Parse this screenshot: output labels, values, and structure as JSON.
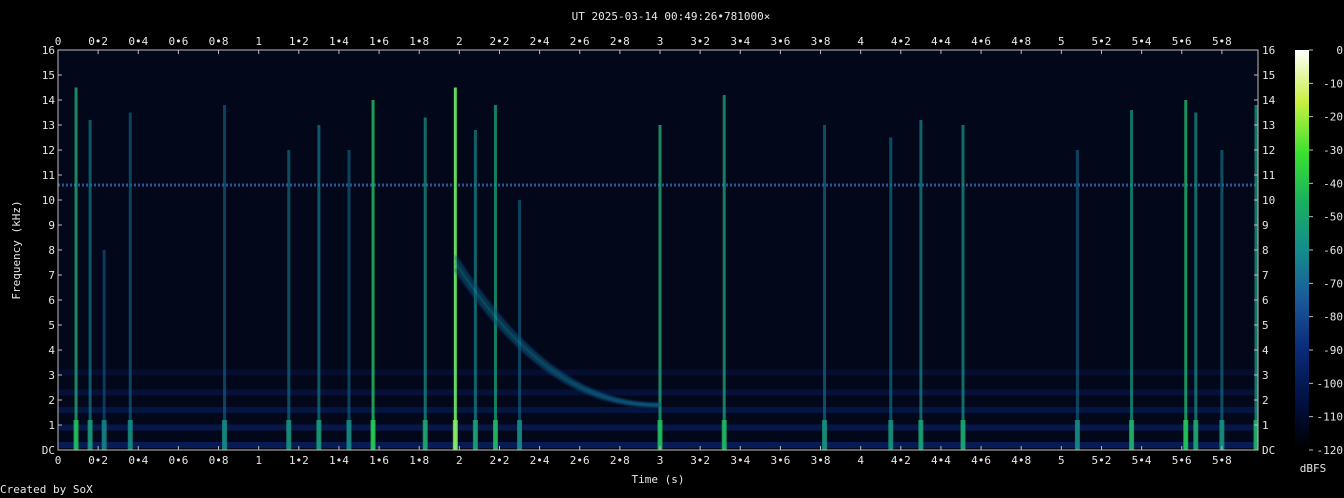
{
  "title": "UT 2025-03-14 00:49:26•781000×",
  "credit": "Created by SoX",
  "chart_data": {
    "type": "heatmap",
    "title": "UT 2025-03-14 00:49:26•781000×",
    "xlabel": "Time (s)",
    "ylabel": "Frequency (kHz)",
    "xlim": [
      0,
      5.98
    ],
    "ylim": [
      0,
      16
    ],
    "x_ticks": [
      "0",
      "0•2",
      "0•4",
      "0•6",
      "0•8",
      "1",
      "1•2",
      "1•4",
      "1•6",
      "1•8",
      "2",
      "2•2",
      "2•4",
      "2•6",
      "2•8",
      "3",
      "3•2",
      "3•4",
      "3•6",
      "3•8",
      "4",
      "4•2",
      "4•4",
      "4•6",
      "4•8",
      "5",
      "5•2",
      "5•4",
      "5•6",
      "5•8"
    ],
    "y_ticks": [
      "DC",
      "1",
      "2",
      "3",
      "4",
      "5",
      "6",
      "7",
      "8",
      "9",
      "10",
      "11",
      "12",
      "13",
      "14",
      "15",
      "16"
    ],
    "colorbar": {
      "label": "dBFS",
      "range": [
        -120,
        0
      ],
      "ticks": [
        "0",
        "-10",
        "-20",
        "-30",
        "-40",
        "-50",
        "-60",
        "-70",
        "-80",
        "-90",
        "-100",
        "-110",
        "-120"
      ],
      "colors": [
        "#000000",
        "#001040",
        "#0a2a78",
        "#1a5a9a",
        "#148c8c",
        "#18b060",
        "#38e030",
        "#c8f040",
        "#ffffff"
      ]
    },
    "background_color": "#03071a",
    "features": {
      "hum_line_khz": 10.6,
      "vertical_bursts": [
        {
          "t": 0.09,
          "top_khz": 14.5,
          "strength": 0.6
        },
        {
          "t": 0.16,
          "top_khz": 13.2,
          "strength": 0.35
        },
        {
          "t": 0.23,
          "top_khz": 8.0,
          "strength": 0.2
        },
        {
          "t": 0.36,
          "top_khz": 13.5,
          "strength": 0.25
        },
        {
          "t": 0.83,
          "top_khz": 13.8,
          "strength": 0.25
        },
        {
          "t": 1.15,
          "top_khz": 12.0,
          "strength": 0.3
        },
        {
          "t": 1.3,
          "top_khz": 13.0,
          "strength": 0.35
        },
        {
          "t": 1.45,
          "top_khz": 12.0,
          "strength": 0.25
        },
        {
          "t": 1.57,
          "top_khz": 14.0,
          "strength": 0.7
        },
        {
          "t": 1.83,
          "top_khz": 13.3,
          "strength": 0.45
        },
        {
          "t": 1.98,
          "top_khz": 14.5,
          "strength": 1.0
        },
        {
          "t": 2.08,
          "top_khz": 12.8,
          "strength": 0.4
        },
        {
          "t": 2.18,
          "top_khz": 13.8,
          "strength": 0.55
        },
        {
          "t": 2.3,
          "top_khz": 10.0,
          "strength": 0.25
        },
        {
          "t": 3.0,
          "top_khz": 13.0,
          "strength": 0.6
        },
        {
          "t": 3.32,
          "top_khz": 14.2,
          "strength": 0.55
        },
        {
          "t": 3.82,
          "top_khz": 13.0,
          "strength": 0.3
        },
        {
          "t": 4.15,
          "top_khz": 12.5,
          "strength": 0.3
        },
        {
          "t": 4.3,
          "top_khz": 13.2,
          "strength": 0.4
        },
        {
          "t": 4.51,
          "top_khz": 13.0,
          "strength": 0.45
        },
        {
          "t": 5.08,
          "top_khz": 12.0,
          "strength": 0.25
        },
        {
          "t": 5.35,
          "top_khz": 13.6,
          "strength": 0.5
        },
        {
          "t": 5.62,
          "top_khz": 14.0,
          "strength": 0.65
        },
        {
          "t": 5.67,
          "top_khz": 13.5,
          "strength": 0.45
        },
        {
          "t": 5.8,
          "top_khz": 12.0,
          "strength": 0.3
        },
        {
          "t": 5.97,
          "top_khz": 13.8,
          "strength": 0.5
        }
      ],
      "whistler": {
        "t_start": 1.98,
        "t_end": 3.0,
        "f_start_khz": 7.5,
        "f_end_khz": 1.8
      }
    }
  }
}
